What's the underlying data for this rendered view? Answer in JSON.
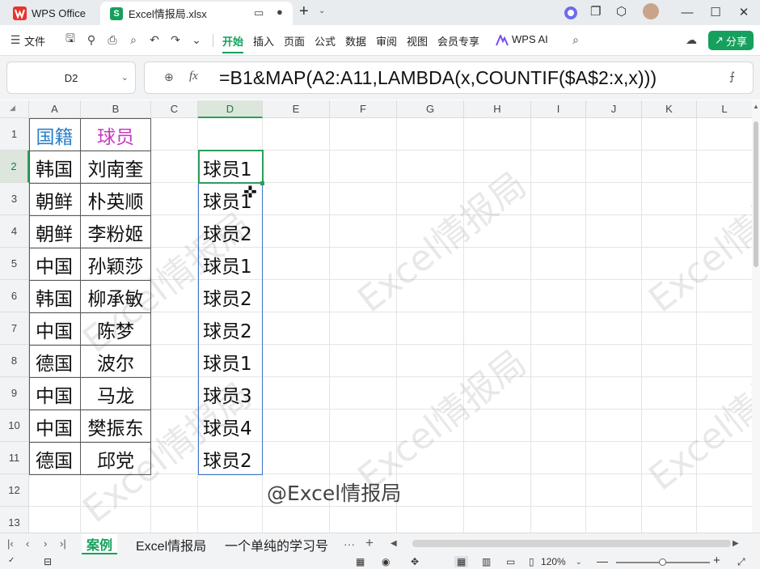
{
  "titlebar": {
    "app_tab": "WPS Office",
    "file_tab": "Excel情报局.xlsx",
    "file_icon_letter": "S"
  },
  "toolbar": {
    "file_menu": "文件",
    "tabs": [
      "开始",
      "插入",
      "页面",
      "公式",
      "数据",
      "审阅",
      "视图",
      "会员专享"
    ],
    "active_tab": "开始",
    "wps_ai": "WPS AI",
    "share": "分享"
  },
  "formula_bar": {
    "cell_ref": "D2",
    "fx_label": "fx",
    "formula": "=B1&MAP(A2:A11,LAMBDA(x,COUNTIF($A$2:x,x)))"
  },
  "sheet": {
    "columns": [
      "A",
      "B",
      "C",
      "D",
      "E",
      "F",
      "G",
      "H",
      "I",
      "J",
      "K",
      "L"
    ],
    "rows": [
      "1",
      "2",
      "3",
      "4",
      "5",
      "6",
      "7",
      "8",
      "9",
      "10",
      "11",
      "12",
      "13"
    ],
    "header_a": "国籍",
    "header_b": "球员",
    "col_a": [
      "韩国",
      "朝鲜",
      "朝鲜",
      "中国",
      "韩国",
      "中国",
      "德国",
      "中国",
      "中国",
      "德国"
    ],
    "col_b": [
      "刘南奎",
      "朴英顺",
      "李粉姬",
      "孙颖莎",
      "柳承敏",
      "陈梦",
      "波尔",
      "马龙",
      "樊振东",
      "邱党"
    ],
    "col_d": [
      "球员1",
      "球员1",
      "球员2",
      "球员1",
      "球员2",
      "球员2",
      "球员1",
      "球员3",
      "球员4",
      "球员2"
    ],
    "watermark": "Excel情报局",
    "credit": "@Excel情报局",
    "colors": {
      "header_a": "#2a7fc9",
      "header_b": "#c63bbf",
      "selection": "#2d9d5c",
      "spill_border": "#3b73c9"
    }
  },
  "sheet_tabs": {
    "tabs": [
      "案例",
      "Excel情报局",
      "一个单纯的学习号"
    ],
    "active": "案例",
    "more": "···",
    "add": "+"
  },
  "statusbar": {
    "zoom": "120%"
  }
}
